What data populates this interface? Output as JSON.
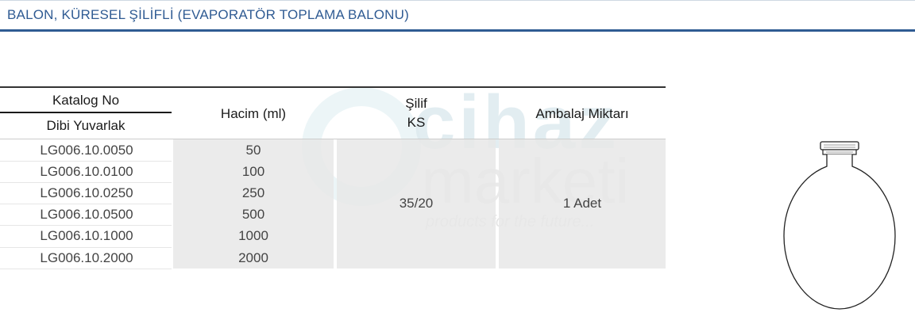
{
  "header": {
    "title": "BALON, KÜRESEL ŞİLİFLİ (EVAPORATÖR TOPLAMA BALONU)"
  },
  "watermark": {
    "brand_top": "cihaz",
    "brand_bottom": "marketi",
    "tagline": "products for the future..."
  },
  "table": {
    "headers": {
      "catalog_top": "Katalog No",
      "catalog_bottom": "Dibi Yuvarlak",
      "volume": "Hacim (ml)",
      "joint_top": "Şilif",
      "joint_bottom": "KS",
      "package": "Ambalaj Miktarı"
    },
    "rows": [
      {
        "code": "LG006.10.0050",
        "volume": "50"
      },
      {
        "code": "LG006.10.0100",
        "volume": "100"
      },
      {
        "code": "LG006.10.0250",
        "volume": "250"
      },
      {
        "code": "LG006.10.0500",
        "volume": "500"
      },
      {
        "code": "LG006.10.1000",
        "volume": "1000"
      },
      {
        "code": "LG006.10.2000",
        "volume": "2000"
      }
    ],
    "joint": "35/20",
    "package": "1 Adet"
  }
}
